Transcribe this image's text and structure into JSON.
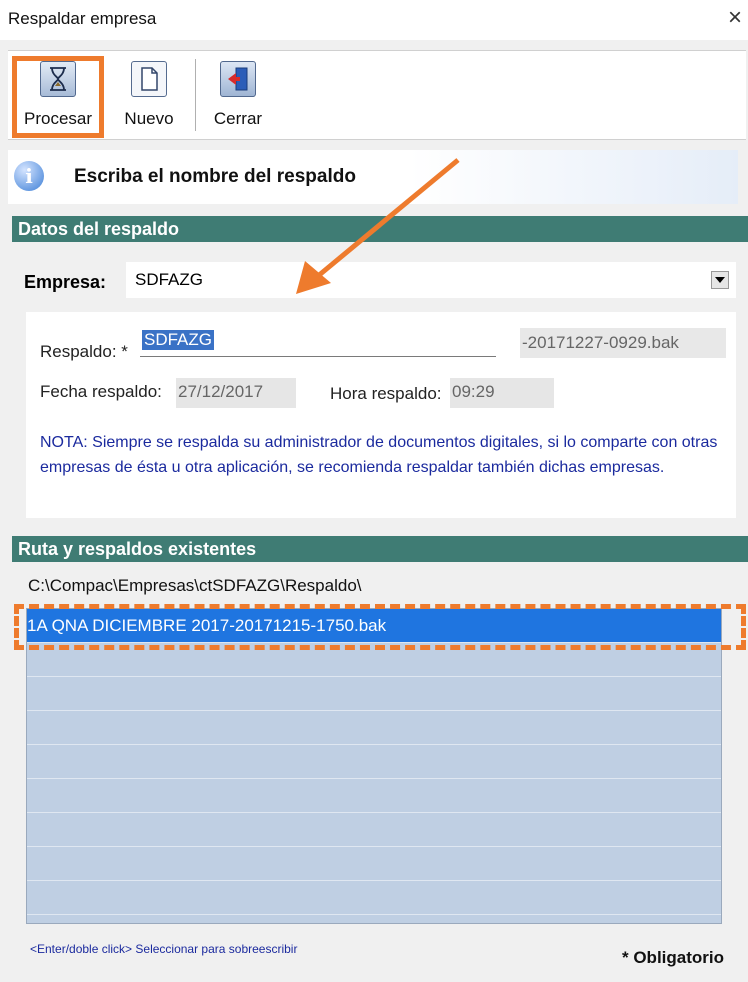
{
  "window": {
    "title": "Respaldar empresa",
    "close": "×"
  },
  "toolbar": {
    "procesar": "Procesar",
    "nuevo": "Nuevo",
    "cerrar": "Cerrar"
  },
  "info": {
    "message": "Escriba el nombre del respaldo"
  },
  "section_datos": "Datos del respaldo",
  "empresa": {
    "label": "Empresa:",
    "value": "SDFAZG"
  },
  "respaldo": {
    "label": "Respaldo: *",
    "value": "SDFAZG",
    "suffix": "-20171227-0929.bak"
  },
  "fecha": {
    "label": "Fecha respaldo:",
    "value": "27/12/2017"
  },
  "hora": {
    "label": "Hora respaldo:",
    "value": "09:29"
  },
  "nota": "NOTA: Siempre se respalda su administrador de documentos digitales, si lo comparte con otras empresas de ésta u otra aplicación, se recomienda respaldar también dichas empresas.",
  "section_ruta": "Ruta y respaldos existentes",
  "ruta": "C:\\Compac\\Empresas\\ctSDFAZG\\Respaldo\\",
  "respaldos": [
    "1A QNA DICIEMBRE 2017-20171215-1750.bak"
  ],
  "hint": "<Enter/doble click> Seleccionar para sobreescribir",
  "obligatorio": "* Obligatorio",
  "colors": {
    "section_header": "#3f7c74",
    "highlight": "#ee7b2d",
    "selection": "#1f75e0",
    "note_text": "#1b2a9e"
  }
}
